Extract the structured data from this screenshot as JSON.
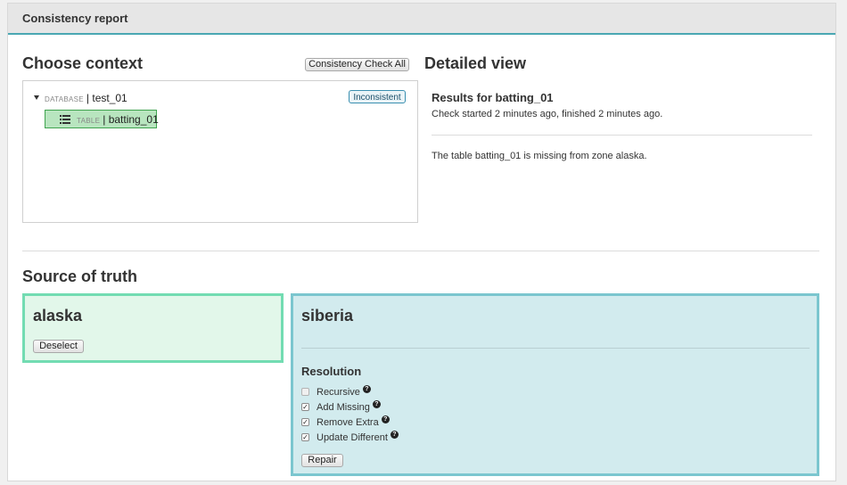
{
  "header": {
    "title": "Consistency report"
  },
  "context": {
    "title": "Choose context",
    "check_all_label": "Consistency Check All",
    "database": {
      "type_label": "DATABASE",
      "name": "| test_01",
      "status": "Inconsistent"
    },
    "table": {
      "type_label": "TABLE",
      "name": "| batting_01"
    }
  },
  "detail": {
    "title": "Detailed view",
    "results_title": "Results for batting_01",
    "check_info": "Check started 2 minutes ago, finished 2 minutes ago.",
    "message": "The table batting_01 is missing from zone alaska."
  },
  "source_of_truth": {
    "title": "Source of truth",
    "selected_zone": {
      "name": "alaska",
      "deselect_label": "Deselect"
    },
    "other_zone": {
      "name": "siberia",
      "resolution_title": "Resolution",
      "options": [
        {
          "label": "Recursive",
          "checked": false
        },
        {
          "label": "Add Missing",
          "checked": true
        },
        {
          "label": "Remove Extra",
          "checked": true
        },
        {
          "label": "Update Different",
          "checked": true
        }
      ],
      "repair_label": "Repair"
    }
  },
  "colors": {
    "accent": "#4aa7b3",
    "alaska_bg": "#e2f7ea",
    "alaska_border": "#72dcb2",
    "siberia_bg": "#d2ebee",
    "siberia_border": "#7bc6cf",
    "table_highlight": "#b8e5bf"
  },
  "icons": {
    "expand": "caret-down-icon",
    "table": "table-list-icon",
    "help": "question-circle-icon"
  }
}
